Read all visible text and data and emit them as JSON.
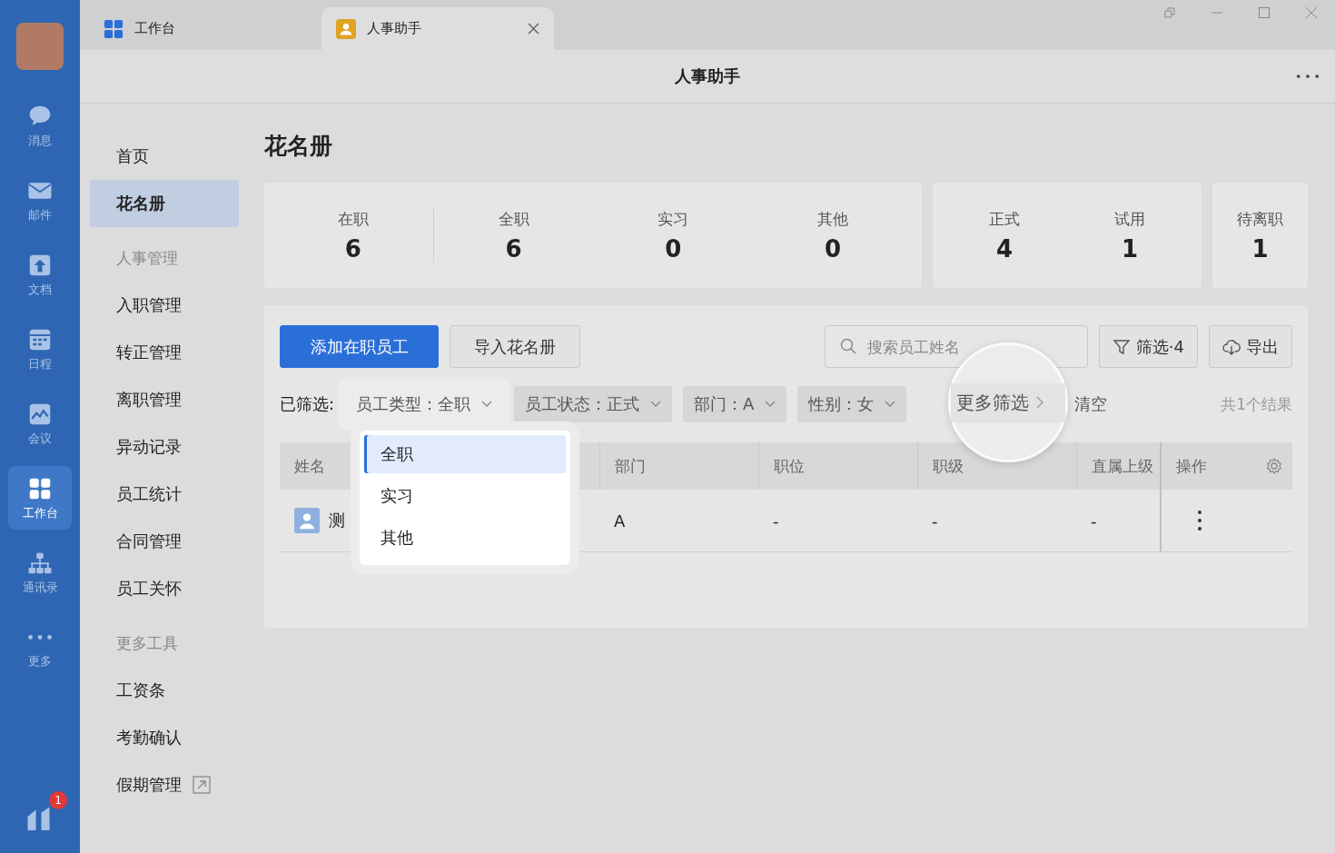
{
  "rail": {
    "items": [
      {
        "label": "消息",
        "kind": "chat",
        "selected": false
      },
      {
        "label": "邮件",
        "kind": "mail",
        "selected": false
      },
      {
        "label": "文档",
        "kind": "doc",
        "selected": false
      },
      {
        "label": "日程",
        "kind": "calendar",
        "selected": false
      },
      {
        "label": "会议",
        "kind": "meeting",
        "selected": false
      },
      {
        "label": "工作台",
        "kind": "grid",
        "selected": true
      },
      {
        "label": "通讯录",
        "kind": "org",
        "selected": false
      },
      {
        "label": "更多",
        "kind": "dots",
        "selected": false
      }
    ],
    "badge": "1"
  },
  "tabs": [
    {
      "label": "工作台",
      "kind": "grid",
      "selected": false,
      "closable": false
    },
    {
      "label": "人事助手",
      "kind": "person",
      "selected": true,
      "closable": true
    }
  ],
  "header": {
    "title": "人事助手"
  },
  "nav": [
    {
      "kind": "link",
      "label": "首页",
      "selected": false,
      "external": false
    },
    {
      "kind": "link",
      "label": "花名册",
      "selected": true,
      "external": false
    },
    {
      "kind": "section",
      "label": "人事管理"
    },
    {
      "kind": "link",
      "label": "入职管理",
      "selected": false,
      "external": false
    },
    {
      "kind": "link",
      "label": "转正管理",
      "selected": false,
      "external": false
    },
    {
      "kind": "link",
      "label": "离职管理",
      "selected": false,
      "external": false
    },
    {
      "kind": "link",
      "label": "异动记录",
      "selected": false,
      "external": false
    },
    {
      "kind": "link",
      "label": "员工统计",
      "selected": false,
      "external": false
    },
    {
      "kind": "link",
      "label": "合同管理",
      "selected": false,
      "external": false
    },
    {
      "kind": "link",
      "label": "员工关怀",
      "selected": false,
      "external": false
    },
    {
      "kind": "section",
      "label": "更多工具"
    },
    {
      "kind": "link",
      "label": "工资条",
      "selected": false,
      "external": false
    },
    {
      "kind": "link",
      "label": "考勤确认",
      "selected": false,
      "external": false
    },
    {
      "kind": "link",
      "label": "假期管理",
      "selected": false,
      "external": true
    }
  ],
  "page_title": "花名册",
  "stat_groups": [
    [
      {
        "label": "在职",
        "value": "6"
      },
      {
        "label": "全职",
        "value": "6"
      },
      {
        "label": "实习",
        "value": "0"
      },
      {
        "label": "其他",
        "value": "0"
      }
    ],
    [
      {
        "label": "正式",
        "value": "4"
      },
      {
        "label": "试用",
        "value": "1"
      }
    ],
    [
      {
        "label": "待离职",
        "value": "1"
      }
    ]
  ],
  "toolbar": {
    "add_button": "添加在职员工",
    "import_button": "导入花名册",
    "search_placeholder": "搜索员工姓名",
    "filter_button": "筛选·4",
    "export_button": "导出"
  },
  "filters": {
    "label": "已筛选:",
    "chips": [
      {
        "label": "员工类型：全职",
        "expanded": true
      },
      {
        "label": "员工状态：正式",
        "expanded": false
      },
      {
        "label": "部门：A",
        "expanded": false
      },
      {
        "label": "性别：女",
        "expanded": false
      }
    ],
    "more": "更多筛选",
    "clear": "清空",
    "result": "共1个结果"
  },
  "dropdown": [
    {
      "label": "全职",
      "selected": true
    },
    {
      "label": "实习",
      "selected": false
    },
    {
      "label": "其他",
      "selected": false
    }
  ],
  "table": {
    "columns": [
      "姓名",
      "",
      "部门",
      "职位",
      "职级",
      "直属上级",
      "操作"
    ],
    "rows": [
      {
        "cells": [
          "测",
          "",
          "A",
          "-",
          "-",
          "-"
        ]
      }
    ]
  }
}
